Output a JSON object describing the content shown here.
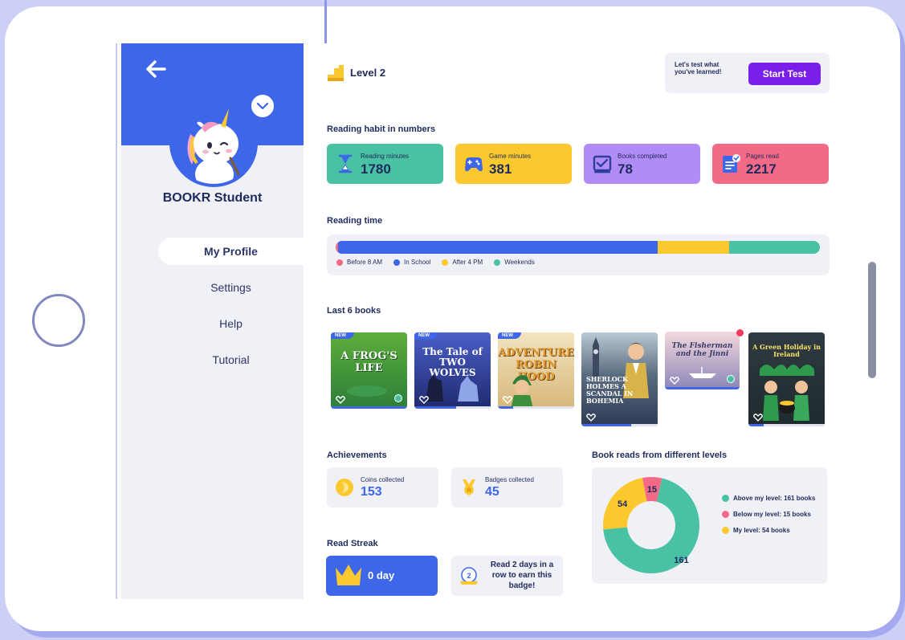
{
  "colors": {
    "brand_blue": "#3d66e8",
    "purple_button": "#7a1fea",
    "teal": "#48c2a3",
    "yellow": "#fbc82d",
    "lavender": "#b28cf6",
    "pink": "#f36a86",
    "text_dark": "#1f2a5c",
    "panel_gray": "#f0f1f6"
  },
  "sidebar": {
    "student_name": "BOOKR Student",
    "items": [
      {
        "label": "My Profile",
        "active": true
      },
      {
        "label": "Settings",
        "active": false
      },
      {
        "label": "Help",
        "active": false
      },
      {
        "label": "Tutorial",
        "active": false
      }
    ]
  },
  "header": {
    "level_label": "Level 2",
    "test_prompt": "Let's test what you've learned!",
    "test_button": "Start Test"
  },
  "habit": {
    "title": "Reading habit in numbers",
    "cards": [
      {
        "label": "Reading minutes",
        "value": "1780",
        "icon": "hourglass-icon",
        "color": "#48c2a3"
      },
      {
        "label": "Game minutes",
        "value": "381",
        "icon": "gamepad-icon",
        "color": "#fbc82d"
      },
      {
        "label": "Books completed",
        "value": "78",
        "icon": "checkbox-icon",
        "color": "#b28cf6"
      },
      {
        "label": "Pages read",
        "value": "2217",
        "icon": "document-icon",
        "color": "#f36a86"
      }
    ]
  },
  "reading_time": {
    "title": "Reading time",
    "segments": [
      {
        "label": "Before 8 AM",
        "share": 0.005,
        "color": "#f36a86"
      },
      {
        "label": "In School",
        "share": 0.66,
        "color": "#3d66e8"
      },
      {
        "label": "After 4 PM",
        "share": 0.147,
        "color": "#fbc82d"
      },
      {
        "label": "Weekends",
        "share": 0.188,
        "color": "#48c2a3"
      }
    ]
  },
  "books": {
    "title": "Last 6 books",
    "new_badge": "NEW",
    "items": [
      {
        "title": "A FROG'S LIFE",
        "new": true,
        "completed": true,
        "progress": 1.0
      },
      {
        "title": "The Tale of TWO WOLVES",
        "new": true,
        "completed": false,
        "progress": 0.55
      },
      {
        "title": "ADVENTURE ROBIN HOOD",
        "new": true,
        "completed": false,
        "progress": 0.2
      },
      {
        "title": "SHERLOCK HOLMES A SCANDAL IN BOHEMIA",
        "new": false,
        "completed": false,
        "progress": 0.65
      },
      {
        "title": "The Fisherman and the Jinni",
        "new": false,
        "completed": true,
        "progress": 1.0
      },
      {
        "title": "A Green Holiday in Ireland",
        "new": false,
        "completed": false,
        "progress": 0.2
      }
    ]
  },
  "achievements": {
    "title": "Achievements",
    "coins_label": "Coins collected",
    "coins_value": "153",
    "badges_label": "Badges collected",
    "badges_value": "45"
  },
  "streak": {
    "title": "Read Streak",
    "value": "0 day",
    "badge_number": "2",
    "hint": "Read 2 days in a row to earn this badge!"
  },
  "levels": {
    "title": "Book reads from different levels",
    "legend": [
      "Above my level: 161 books",
      "Below my level: 15 books",
      "My level: 54 books"
    ]
  },
  "chart_data": {
    "type": "pie",
    "title": "Book reads from different levels",
    "categories": [
      "Above my level",
      "Below my level",
      "My level"
    ],
    "values": [
      161,
      15,
      54
    ],
    "colors": [
      "#48c2a3",
      "#f36a86",
      "#fbc82d"
    ],
    "labels": [
      "161",
      "15",
      "54"
    ]
  }
}
